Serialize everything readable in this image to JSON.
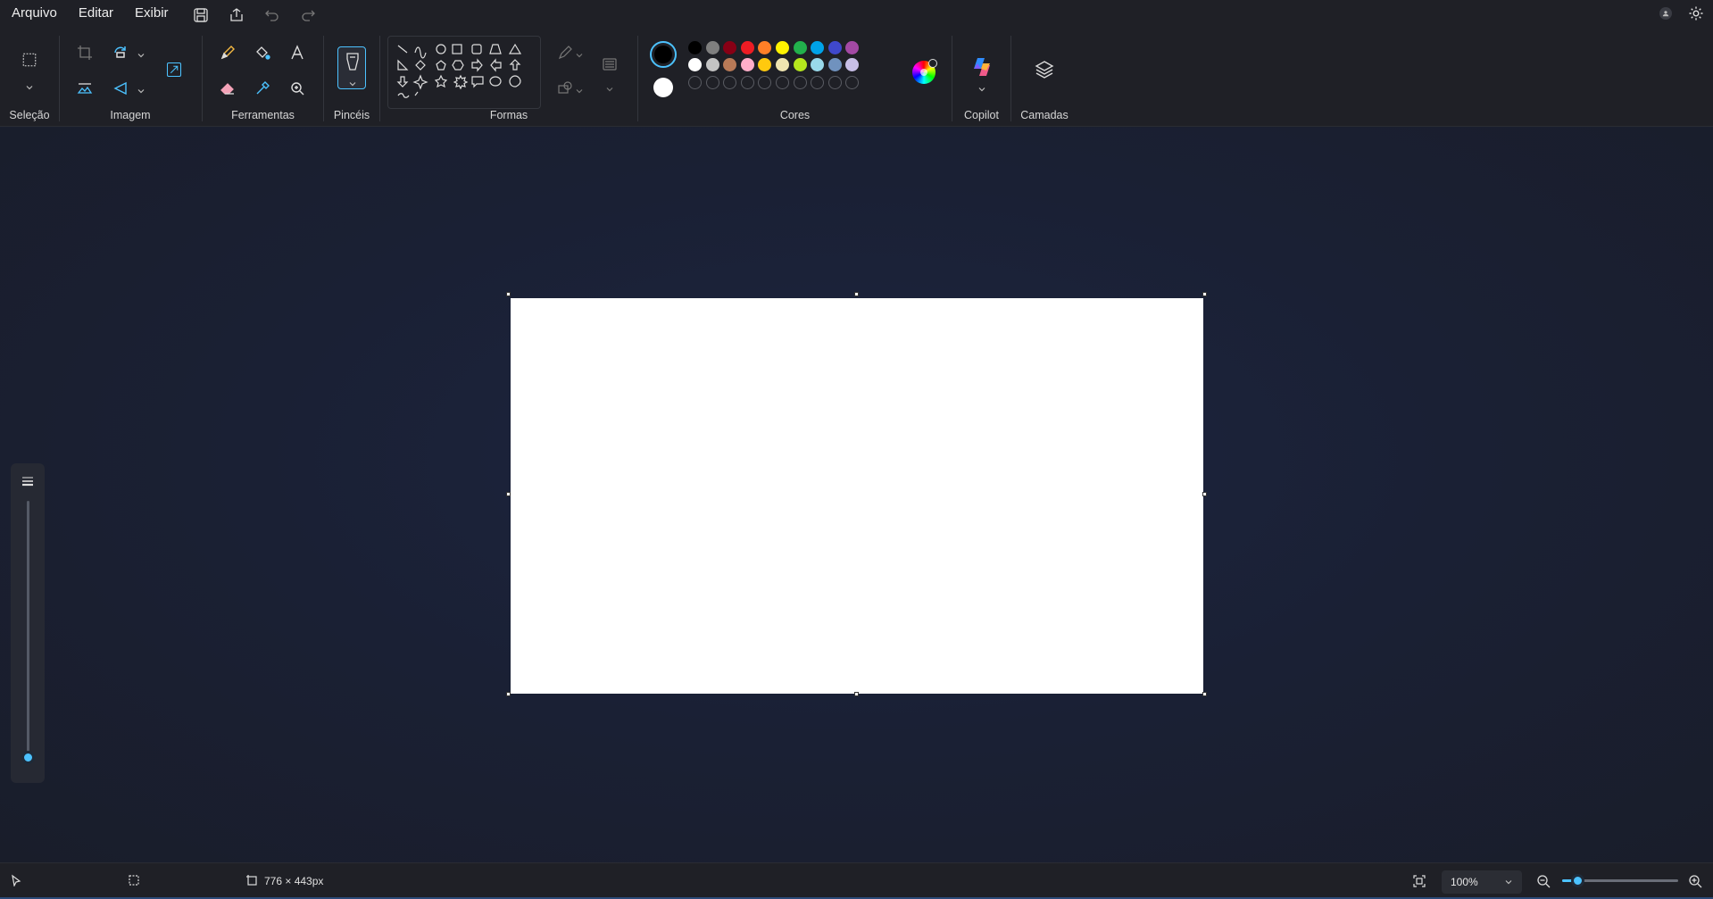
{
  "menu": {
    "file": "Arquivo",
    "edit": "Editar",
    "view": "Exibir"
  },
  "ribbon": {
    "selection": "Seleção",
    "image": "Imagem",
    "tools": "Ferramentas",
    "brushes": "Pincéis",
    "shapes": "Formas",
    "colors": "Cores",
    "copilot": "Copilot",
    "layers": "Camadas"
  },
  "palette": {
    "primary": "#000000",
    "secondary": "#ffffff",
    "row1": [
      "#000000",
      "#7f7f7f",
      "#880015",
      "#ed1c24",
      "#ff7f27",
      "#fff200",
      "#22b14c",
      "#00a2e8",
      "#3f48cc",
      "#a349a4"
    ],
    "row2": [
      "#ffffff",
      "#c3c3c3",
      "#b97a57",
      "#ffaec9",
      "#ffc90e",
      "#efe4b0",
      "#b5e61d",
      "#99d9ea",
      "#7092be",
      "#c8bfe7"
    ],
    "row3_empty": 10
  },
  "status": {
    "canvas_size": "776 × 443px",
    "zoom": "100%",
    "zoom_level": 0.13
  }
}
